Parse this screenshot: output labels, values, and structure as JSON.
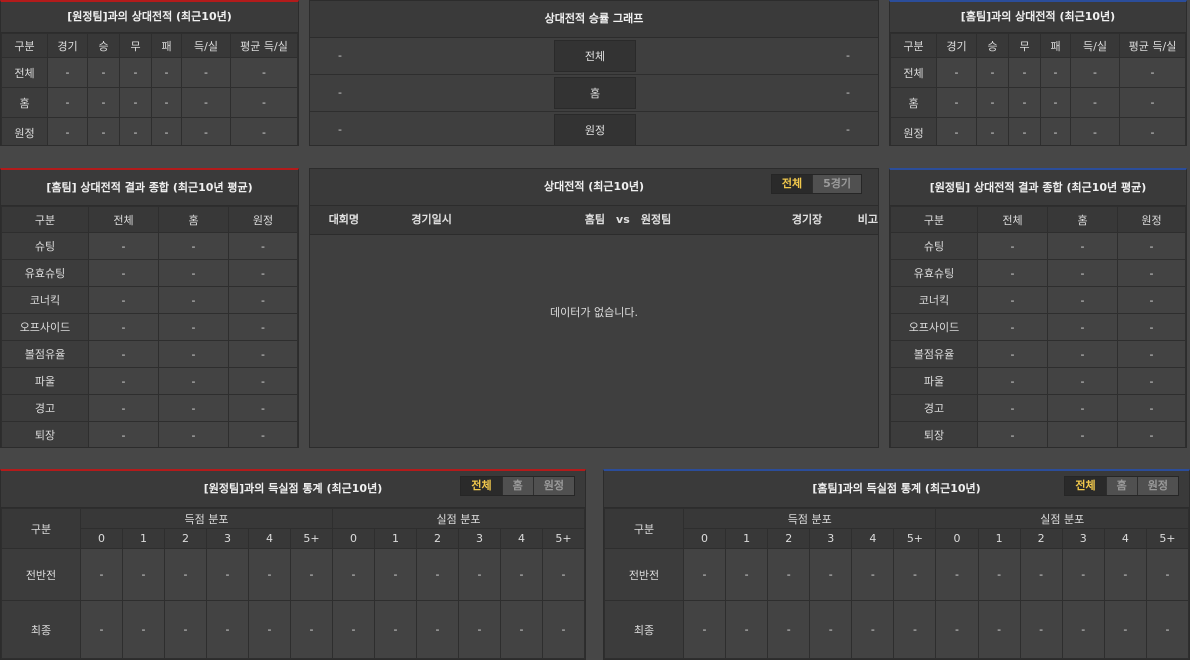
{
  "summary_left": {
    "title": "[원정팀]과의 상대전적 (최근10년)",
    "headers": [
      "구분",
      "경기",
      "승",
      "무",
      "패",
      "득/실",
      "평균 득/실"
    ],
    "rows": [
      {
        "label": "전체",
        "values": [
          "-",
          "-",
          "-",
          "-",
          "-",
          "-"
        ]
      },
      {
        "label": "홈",
        "values": [
          "-",
          "-",
          "-",
          "-",
          "-",
          "-"
        ]
      },
      {
        "label": "원정",
        "values": [
          "-",
          "-",
          "-",
          "-",
          "-",
          "-"
        ]
      }
    ]
  },
  "graph": {
    "title": "상대전적 승률 그래프",
    "rows": [
      {
        "left": "-",
        "label": "전체",
        "right": "-"
      },
      {
        "left": "-",
        "label": "홈",
        "right": "-"
      },
      {
        "left": "-",
        "label": "원정",
        "right": "-"
      }
    ]
  },
  "summary_right": {
    "title": "[홈팀]과의 상대전적 (최근10년)",
    "headers": [
      "구분",
      "경기",
      "승",
      "무",
      "패",
      "득/실",
      "평균 득/실"
    ],
    "rows": [
      {
        "label": "전체",
        "values": [
          "-",
          "-",
          "-",
          "-",
          "-",
          "-"
        ]
      },
      {
        "label": "홈",
        "values": [
          "-",
          "-",
          "-",
          "-",
          "-",
          "-"
        ]
      },
      {
        "label": "원정",
        "values": [
          "-",
          "-",
          "-",
          "-",
          "-",
          "-"
        ]
      }
    ]
  },
  "stats_left": {
    "title": "[홈팀] 상대전적 결과 종합 (최근10년 평균)",
    "headers": [
      "구분",
      "전체",
      "홈",
      "원정"
    ],
    "rows": [
      {
        "label": "슈팅",
        "values": [
          "-",
          "-",
          "-"
        ]
      },
      {
        "label": "유효슈팅",
        "values": [
          "-",
          "-",
          "-"
        ]
      },
      {
        "label": "코너킥",
        "values": [
          "-",
          "-",
          "-"
        ]
      },
      {
        "label": "오프사이드",
        "values": [
          "-",
          "-",
          "-"
        ]
      },
      {
        "label": "볼점유율",
        "values": [
          "-",
          "-",
          "-"
        ]
      },
      {
        "label": "파울",
        "values": [
          "-",
          "-",
          "-"
        ]
      },
      {
        "label": "경고",
        "values": [
          "-",
          "-",
          "-"
        ]
      },
      {
        "label": "퇴장",
        "values": [
          "-",
          "-",
          "-"
        ]
      }
    ]
  },
  "matches": {
    "title": "상대전적 (최근10년)",
    "tabs": [
      "전체",
      "5경기"
    ],
    "headers": {
      "competition": "대회명",
      "date": "경기일시",
      "home": "홈팀",
      "vs": "vs",
      "away": "원정팀",
      "venue": "경기장",
      "note": "비고"
    },
    "empty": "데이터가 없습니다."
  },
  "stats_right": {
    "title": "[원정팀] 상대전적 결과 종합 (최근10년 평균)",
    "headers": [
      "구분",
      "전체",
      "홈",
      "원정"
    ],
    "rows": [
      {
        "label": "슈팅",
        "values": [
          "-",
          "-",
          "-"
        ]
      },
      {
        "label": "유효슈팅",
        "values": [
          "-",
          "-",
          "-"
        ]
      },
      {
        "label": "코너킥",
        "values": [
          "-",
          "-",
          "-"
        ]
      },
      {
        "label": "오프사이드",
        "values": [
          "-",
          "-",
          "-"
        ]
      },
      {
        "label": "볼점유율",
        "values": [
          "-",
          "-",
          "-"
        ]
      },
      {
        "label": "파울",
        "values": [
          "-",
          "-",
          "-"
        ]
      },
      {
        "label": "경고",
        "values": [
          "-",
          "-",
          "-"
        ]
      },
      {
        "label": "퇴장",
        "values": [
          "-",
          "-",
          "-"
        ]
      }
    ]
  },
  "goals_left": {
    "title": "[원정팀]과의 득실점 통계 (최근10년)",
    "tabs": [
      "전체",
      "홈",
      "원정"
    ],
    "category": "구분",
    "scored": "득점 분포",
    "conceded": "실점 분포",
    "buckets": [
      "0",
      "1",
      "2",
      "3",
      "4",
      "5+"
    ],
    "rows": [
      {
        "label": "전반전",
        "scored": [
          "-",
          "-",
          "-",
          "-",
          "-",
          "-"
        ],
        "conceded": [
          "-",
          "-",
          "-",
          "-",
          "-",
          "-"
        ]
      },
      {
        "label": "최종",
        "scored": [
          "-",
          "-",
          "-",
          "-",
          "-",
          "-"
        ],
        "conceded": [
          "-",
          "-",
          "-",
          "-",
          "-",
          "-"
        ]
      }
    ]
  },
  "goals_right": {
    "title": "[홈팀]과의 득실점 통계 (최근10년)",
    "tabs": [
      "전체",
      "홈",
      "원정"
    ],
    "category": "구분",
    "scored": "득점 분포",
    "conceded": "실점 분포",
    "buckets": [
      "0",
      "1",
      "2",
      "3",
      "4",
      "5+"
    ],
    "rows": [
      {
        "label": "전반전",
        "scored": [
          "-",
          "-",
          "-",
          "-",
          "-",
          "-"
        ],
        "conceded": [
          "-",
          "-",
          "-",
          "-",
          "-",
          "-"
        ]
      },
      {
        "label": "최종",
        "scored": [
          "-",
          "-",
          "-",
          "-",
          "-",
          "-"
        ],
        "conceded": [
          "-",
          "-",
          "-",
          "-",
          "-",
          "-"
        ]
      }
    ]
  }
}
